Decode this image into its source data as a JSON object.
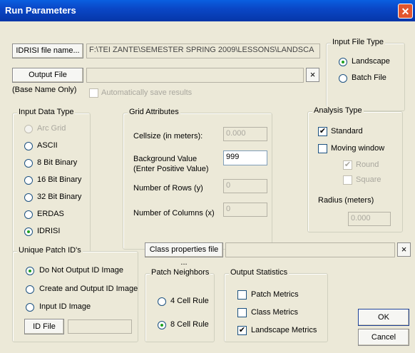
{
  "window": {
    "title": "Run Parameters",
    "close_glyph": "✕"
  },
  "input_file": {
    "button": "IDRISI file name...",
    "value": "F:\\TEI ZANTE\\SEMESTER SPRING 2009\\LESSONS\\LANDSCA"
  },
  "output_file": {
    "button": "Output File",
    "value": "",
    "clear": "×",
    "note": "(Base Name Only)",
    "auto_save": {
      "label": "Automatically save results",
      "checked": false
    }
  },
  "input_file_type": {
    "title": "Input File Type",
    "options": [
      "Landscape",
      "Batch File"
    ],
    "selected": "Landscape"
  },
  "input_data_type": {
    "title": "Input Data Type",
    "options": [
      "Arc Grid",
      "ASCII",
      "8 Bit Binary",
      "16 Bit Binary",
      "32 Bit Binary",
      "ERDAS",
      "IDRISI"
    ],
    "selected": "IDRISI"
  },
  "grid_attributes": {
    "title": "Grid Attributes",
    "cellsize": {
      "label": "Cellsize (in meters):",
      "value": "0.000"
    },
    "background": {
      "label1": "Background Value",
      "label2": "(Enter Positive Value)",
      "value": "999"
    },
    "rows": {
      "label": "Number of Rows (y)",
      "value": "0"
    },
    "cols": {
      "label": "Number of Columns (x)",
      "value": "0"
    }
  },
  "analysis_type": {
    "title": "Analysis Type",
    "standard": {
      "label": "Standard",
      "checked": true
    },
    "moving_window": {
      "label": "Moving window",
      "checked": false
    },
    "round": {
      "label": "Round",
      "checked": true
    },
    "square": {
      "label": "Square",
      "checked": false
    },
    "radius_label": "Radius (meters)",
    "radius_value": "0.000"
  },
  "unique_patch_ids": {
    "title": "Unique Patch ID's",
    "options": [
      "Do Not Output ID Image",
      "Create and Output ID Image",
      "Input ID Image"
    ],
    "selected": "Do Not Output ID Image",
    "id_file_button": "ID File",
    "id_file_value": ""
  },
  "class_properties": {
    "button": "Class properties file ...",
    "value": "",
    "clear": "×"
  },
  "patch_neighbors": {
    "title": "Patch Neighbors",
    "options": [
      "4 Cell Rule",
      "8 Cell Rule"
    ],
    "selected": "8 Cell Rule"
  },
  "output_statistics": {
    "title": "Output Statistics",
    "patch": {
      "label": "Patch Metrics",
      "checked": false
    },
    "class": {
      "label": "Class Metrics",
      "checked": false
    },
    "landscape": {
      "label": "Landscape Metrics",
      "checked": true
    }
  },
  "actions": {
    "ok": "OK",
    "cancel": "Cancel"
  },
  "colors": {
    "titlebar": "#0a47c7",
    "face": "#ece9d8",
    "close": "#e2552e"
  }
}
